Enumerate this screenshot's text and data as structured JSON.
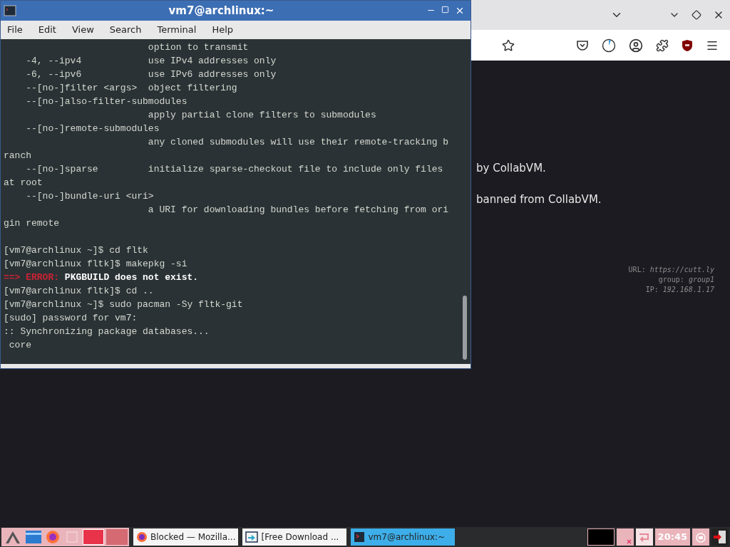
{
  "browser": {
    "content_lines": [
      "by CollabVM.",
      "banned from CollabVM."
    ],
    "overlay": [
      {
        "label": "URL:",
        "value": "https://cutt.ly"
      },
      {
        "label": "group:",
        "value": "group1"
      },
      {
        "label": "IP:",
        "value": "192.168.1.17"
      }
    ]
  },
  "terminal": {
    "title": "vm7@archlinux:~",
    "menu": [
      "File",
      "Edit",
      "View",
      "Search",
      "Terminal",
      "Help"
    ],
    "output": [
      "                          option to transmit",
      "    -4, --ipv4            use IPv4 addresses only",
      "    -6, --ipv6            use IPv6 addresses only",
      "    --[no-]filter <args>  object filtering",
      "    --[no-]also-filter-submodules",
      "                          apply partial clone filters to submodules",
      "    --[no-]remote-submodules",
      "                          any cloned submodules will use their remote-tracking b",
      "ranch",
      "    --[no-]sparse         initialize sparse-checkout file to include only files",
      "at root",
      "    --[no-]bundle-uri <uri>",
      "                          a URI for downloading bundles before fetching from ori",
      "gin remote"
    ],
    "session": [
      {
        "kind": "text",
        "text": "[vm7@archlinux ~]$ cd fltk"
      },
      {
        "kind": "text",
        "text": "[vm7@archlinux fltk]$ makepkg -si"
      },
      {
        "kind": "error",
        "marker": "==> ERROR:",
        "text": "PKGBUILD does not exist."
      },
      {
        "kind": "text",
        "text": "[vm7@archlinux fltk]$ cd .."
      },
      {
        "kind": "text",
        "text": "[vm7@archlinux ~]$ sudo pacman -Sy fltk-git"
      },
      {
        "kind": "text",
        "text": "[sudo] password for vm7:"
      },
      {
        "kind": "text",
        "text": ":: Synchronizing package databases..."
      },
      {
        "kind": "text",
        "text": " core"
      }
    ]
  },
  "taskbar": {
    "windows": [
      {
        "label": "Blocked — Mozilla...",
        "selected": false
      },
      {
        "label": "[Free Download ...",
        "selected": false
      },
      {
        "label": "vm7@archlinux:~",
        "selected": true
      }
    ],
    "clock": "20:45"
  }
}
